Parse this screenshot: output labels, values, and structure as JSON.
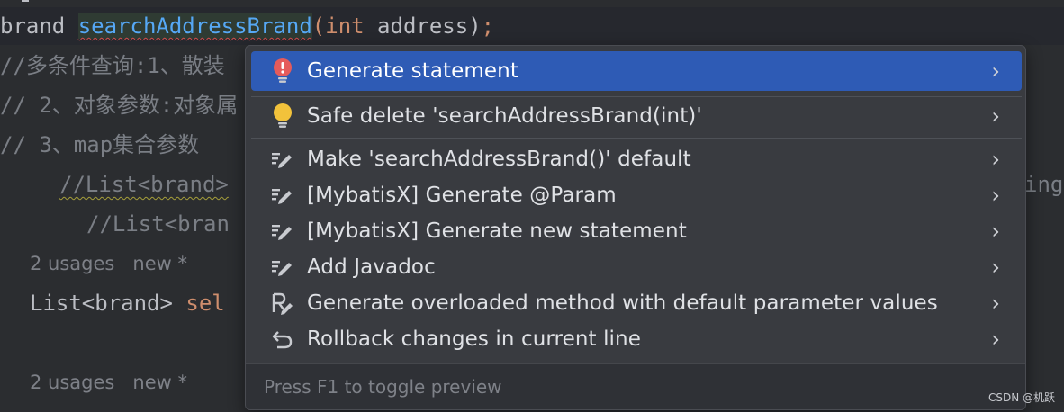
{
  "editor": {
    "line1": {
      "type": "brand",
      "method": "searchAddressBrand",
      "paren_open": "(",
      "param_type": "int",
      "param_name": " address",
      "paren_close": ")",
      "semi": ";"
    },
    "line2": "//多条件查询:1、散装",
    "line3": "// 2、对象参数:对象属",
    "line4": "// 3、map集合参数",
    "line5": "//List<brand>",
    "line5_tail": "ing",
    "line6": "//List<bran",
    "hint1": {
      "usages": "2 usages",
      "new": "new *"
    },
    "line7": {
      "type": "List<brand>",
      "name": " sel"
    },
    "hint2": {
      "usages": "2 usages",
      "new": "new *"
    }
  },
  "popup": {
    "items": [
      {
        "icon": "error-bulb-icon",
        "label": "Generate statement",
        "selected": true
      },
      {
        "icon": "lightbulb-icon",
        "label": "Safe delete 'searchAddressBrand(int)'"
      },
      {
        "icon": "edit-intention-icon",
        "label": "Make 'searchAddressBrand()' default"
      },
      {
        "icon": "edit-intention-icon",
        "label": "[MybatisX] Generate @Param"
      },
      {
        "icon": "edit-intention-icon",
        "label": "[MybatisX] Generate new statement"
      },
      {
        "icon": "edit-intention-icon",
        "label": "Add Javadoc"
      },
      {
        "icon": "parameter-intention-icon",
        "label": "Generate overloaded method with default parameter values"
      },
      {
        "icon": "rollback-icon",
        "label": "Rollback changes in current line"
      }
    ],
    "footer": "Press F1 to toggle preview"
  },
  "watermark": "CSDN @机跃",
  "colors": {
    "selection": "#2e5bb5",
    "popup_bg": "#393b40",
    "editor_bg": "#2b2d30",
    "keyword": "#cf8e6d",
    "method": "#56a8f5",
    "error_icon": "#e55b5b",
    "bulb_icon": "#f2c23b"
  }
}
